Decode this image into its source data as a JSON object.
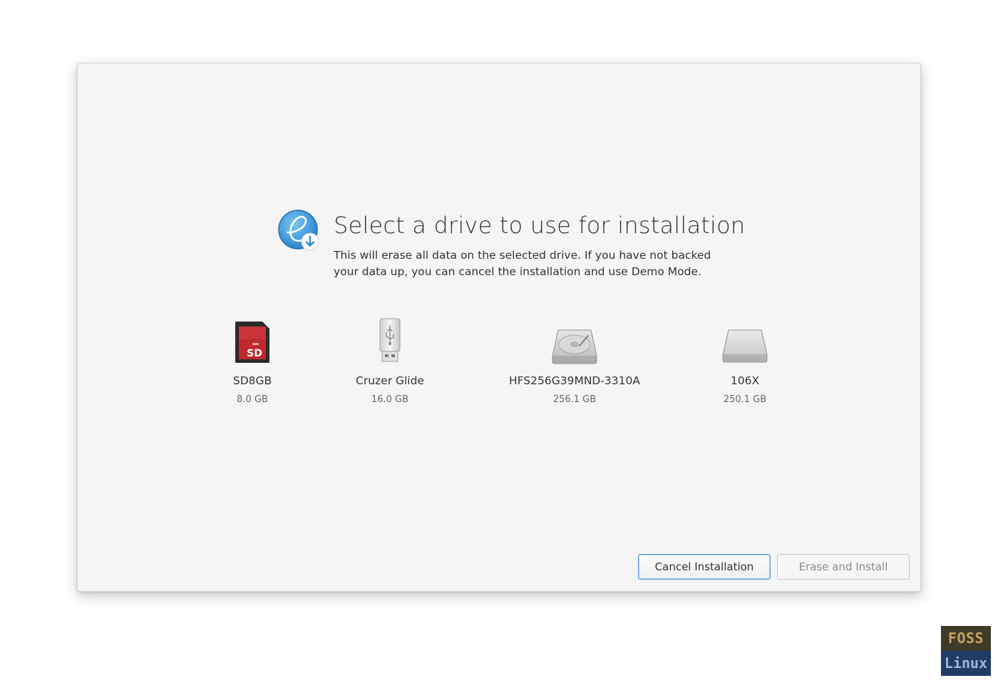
{
  "header": {
    "title": "Select a drive to use for installation",
    "description": "This will erase all data on the selected drive. If you have not backed your data up, you can cancel the installation and use Demo Mode."
  },
  "drives": [
    {
      "name": "SD8GB",
      "size": "8.0 GB",
      "icon": "sd-card-icon",
      "badge": "SD"
    },
    {
      "name": "Cruzer Glide",
      "size": "16.0 GB",
      "icon": "usb-drive-icon"
    },
    {
      "name": "HFS256G39MND-3310A",
      "size": "256.1 GB",
      "icon": "hard-drive-icon"
    },
    {
      "name": "106X",
      "size": "250.1 GB",
      "icon": "ssd-drive-icon"
    }
  ],
  "buttons": {
    "cancel_label": "Cancel Installation",
    "erase_label": "Erase and Install"
  },
  "watermark": {
    "line1": "FOSS",
    "line2": "Linux"
  },
  "colors": {
    "accent": "#5c9ad6",
    "window_bg": "#f5f5f5",
    "sd_red": "#c0282d",
    "logo_blue": "#3b9bdb"
  }
}
